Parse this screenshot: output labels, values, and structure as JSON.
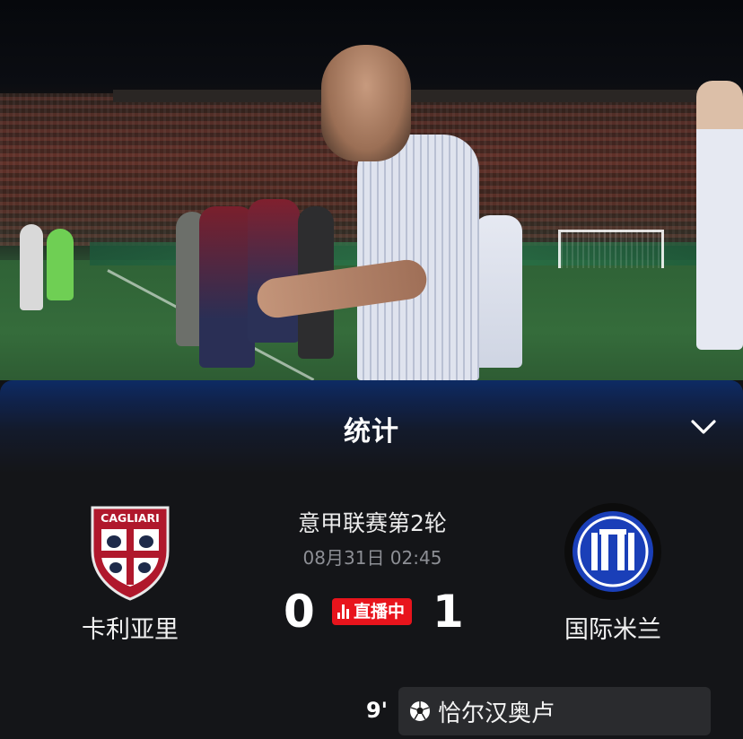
{
  "panel": {
    "title": "统计"
  },
  "match": {
    "competition": "意甲联赛第2轮",
    "datetime": "08月31日 02:45",
    "home_team": {
      "name": "卡利亚里",
      "logo_text": "CAGLIARI",
      "score": "0"
    },
    "away_team": {
      "name": "国际米兰",
      "score": "1"
    },
    "live_label": "直播中"
  },
  "events": [
    {
      "minute": "9'",
      "type": "goal",
      "icon": "soccer-ball-icon",
      "player": "恰尔汉奥卢"
    }
  ],
  "colors": {
    "live_red": "#e8141c",
    "inter_blue": "#1a3fb8",
    "cagliari_red": "#b0182c"
  }
}
